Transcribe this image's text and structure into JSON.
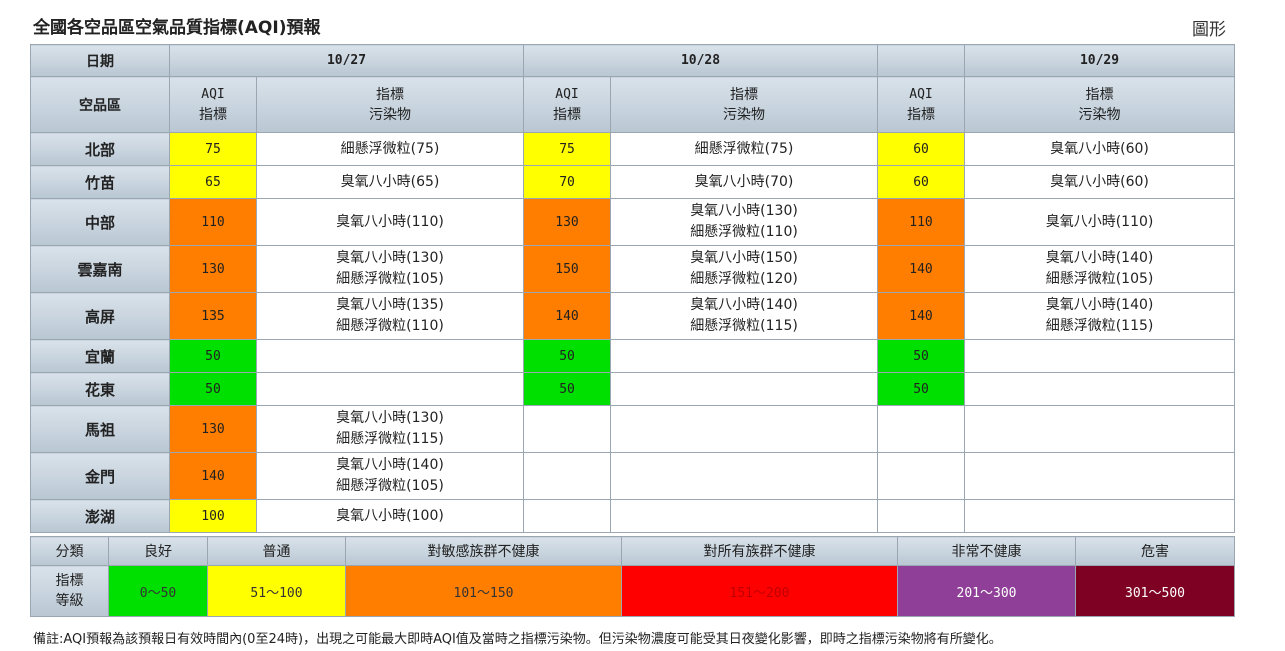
{
  "title": "全國各空品區空氣品質指標(AQI)預報",
  "graph_link": "圖形",
  "header": {
    "date_label": "日期",
    "region_label": "空品區",
    "aqi_label_1": "AQI",
    "aqi_label_2": "指標",
    "poll_label_1": "指標",
    "poll_label_2": "污染物",
    "dates": [
      "10/27",
      "10/28",
      "10/29"
    ]
  },
  "colors": {
    "good": "#00e000",
    "moderate": "#ffff00",
    "sensitive": "#ff7e00",
    "unhealthy": "#ff0000",
    "very_unhealthy": "#8f3f97",
    "hazardous": "#7e0023"
  },
  "rows": [
    {
      "region": "北部",
      "d1": {
        "aqi": "75",
        "level": "moderate",
        "poll": [
          "細懸浮微粒(75)"
        ]
      },
      "d2": {
        "aqi": "75",
        "level": "moderate",
        "poll": [
          "細懸浮微粒(75)"
        ]
      },
      "d3": {
        "aqi": "60",
        "level": "moderate",
        "poll": [
          "臭氧八小時(60)"
        ]
      }
    },
    {
      "region": "竹苗",
      "d1": {
        "aqi": "65",
        "level": "moderate",
        "poll": [
          "臭氧八小時(65)"
        ]
      },
      "d2": {
        "aqi": "70",
        "level": "moderate",
        "poll": [
          "臭氧八小時(70)"
        ]
      },
      "d3": {
        "aqi": "60",
        "level": "moderate",
        "poll": [
          "臭氧八小時(60)"
        ]
      }
    },
    {
      "region": "中部",
      "d1": {
        "aqi": "110",
        "level": "sensitive",
        "poll": [
          "臭氧八小時(110)"
        ]
      },
      "d2": {
        "aqi": "130",
        "level": "sensitive",
        "poll": [
          "臭氧八小時(130)",
          "細懸浮微粒(110)"
        ]
      },
      "d3": {
        "aqi": "110",
        "level": "sensitive",
        "poll": [
          "臭氧八小時(110)"
        ]
      }
    },
    {
      "region": "雲嘉南",
      "d1": {
        "aqi": "130",
        "level": "sensitive",
        "poll": [
          "臭氧八小時(130)",
          "細懸浮微粒(105)"
        ]
      },
      "d2": {
        "aqi": "150",
        "level": "sensitive",
        "poll": [
          "臭氧八小時(150)",
          "細懸浮微粒(120)"
        ]
      },
      "d3": {
        "aqi": "140",
        "level": "sensitive",
        "poll": [
          "臭氧八小時(140)",
          "細懸浮微粒(105)"
        ]
      }
    },
    {
      "region": "高屏",
      "d1": {
        "aqi": "135",
        "level": "sensitive",
        "poll": [
          "臭氧八小時(135)",
          "細懸浮微粒(110)"
        ]
      },
      "d2": {
        "aqi": "140",
        "level": "sensitive",
        "poll": [
          "臭氧八小時(140)",
          "細懸浮微粒(115)"
        ]
      },
      "d3": {
        "aqi": "140",
        "level": "sensitive",
        "poll": [
          "臭氧八小時(140)",
          "細懸浮微粒(115)"
        ]
      }
    },
    {
      "region": "宜蘭",
      "d1": {
        "aqi": "50",
        "level": "good",
        "poll": []
      },
      "d2": {
        "aqi": "50",
        "level": "good",
        "poll": []
      },
      "d3": {
        "aqi": "50",
        "level": "good",
        "poll": []
      }
    },
    {
      "region": "花東",
      "d1": {
        "aqi": "50",
        "level": "good",
        "poll": []
      },
      "d2": {
        "aqi": "50",
        "level": "good",
        "poll": []
      },
      "d3": {
        "aqi": "50",
        "level": "good",
        "poll": []
      }
    },
    {
      "region": "馬祖",
      "d1": {
        "aqi": "130",
        "level": "sensitive",
        "poll": [
          "臭氧八小時(130)",
          "細懸浮微粒(115)"
        ]
      },
      "d2": {
        "aqi": "",
        "level": "",
        "poll": []
      },
      "d3": {
        "aqi": "",
        "level": "",
        "poll": []
      }
    },
    {
      "region": "金門",
      "d1": {
        "aqi": "140",
        "level": "sensitive",
        "poll": [
          "臭氧八小時(140)",
          "細懸浮微粒(105)"
        ]
      },
      "d2": {
        "aqi": "",
        "level": "",
        "poll": []
      },
      "d3": {
        "aqi": "",
        "level": "",
        "poll": []
      }
    },
    {
      "region": "澎湖",
      "d1": {
        "aqi": "100",
        "level": "moderate",
        "poll": [
          "臭氧八小時(100)"
        ]
      },
      "d2": {
        "aqi": "",
        "level": "",
        "poll": []
      },
      "d3": {
        "aqi": "",
        "level": "",
        "poll": []
      }
    }
  ],
  "legend": {
    "category_label": "分類",
    "index_label_1": "指標",
    "index_label_2": "等級",
    "levels": [
      {
        "name": "良好",
        "range": "0～50",
        "level": "good",
        "text": "#333"
      },
      {
        "name": "普通",
        "range": "51～100",
        "level": "moderate",
        "text": "#333"
      },
      {
        "name": "對敏感族群不健康",
        "range": "101～150",
        "level": "sensitive",
        "text": "#333"
      },
      {
        "name": "對所有族群不健康",
        "range": "151～200",
        "level": "unhealthy",
        "text": "#c00000"
      },
      {
        "name": "非常不健康",
        "range": "201～300",
        "level": "very_unhealthy",
        "text": "#ffffff"
      },
      {
        "name": "危害",
        "range": "301～500",
        "level": "hazardous",
        "text": "#ffffff"
      }
    ]
  },
  "note": "備註:AQI預報為該預報日有效時間內(0至24時)，出現之可能最大即時AQI值及當時之指標污染物。但污染物濃度可能受其日夜變化影響，即時之指標污染物將有所變化。"
}
